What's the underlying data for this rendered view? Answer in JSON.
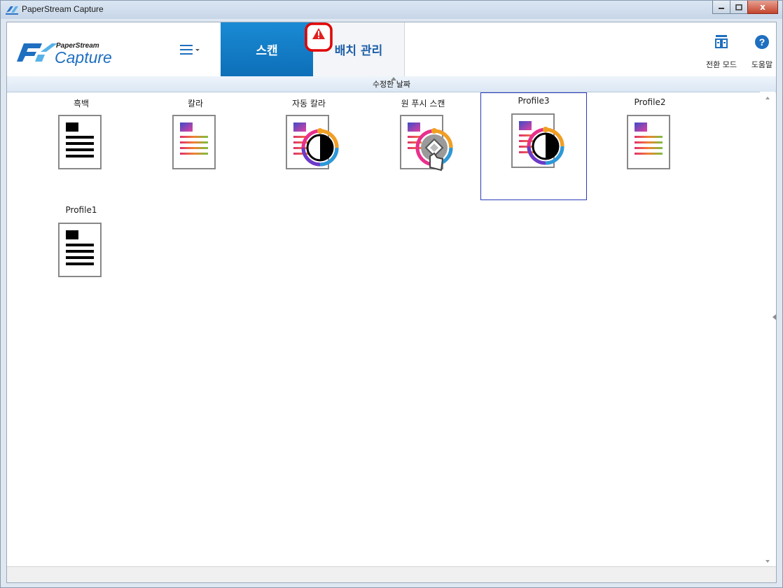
{
  "window": {
    "title": "PaperStream Capture",
    "buttons": [
      "minimize",
      "maximize",
      "close"
    ],
    "close_glyph": "x"
  },
  "header": {
    "logo_top": "PaperStream",
    "logo_bottom": "Capture",
    "menu_icon": "hamburger-menu-icon",
    "tabs": [
      {
        "label": "스캔",
        "active": true
      },
      {
        "label": "배치 관리",
        "active": false,
        "badge": "warning-icon"
      }
    ],
    "actions": [
      {
        "label": "전환 모드",
        "icon": "switch-mode-icon"
      },
      {
        "label": "도움말",
        "icon": "help-icon"
      }
    ],
    "accent": "#0f76c2"
  },
  "sort": {
    "label": "수정한 날짜"
  },
  "profiles": [
    {
      "name": "흑백",
      "icon": "bw-document-icon"
    },
    {
      "name": "칼라",
      "icon": "color-document-icon"
    },
    {
      "name": "자동 칼라",
      "icon": "auto-color-document-icon"
    },
    {
      "name": "원 푸시 스캔",
      "icon": "one-push-scan-icon"
    },
    {
      "name": "Profile3",
      "icon": "auto-color-document-icon",
      "selected": true
    },
    {
      "name": "Profile2",
      "icon": "color-document-icon"
    },
    {
      "name": "Profile1",
      "icon": "bw-document-icon"
    }
  ]
}
